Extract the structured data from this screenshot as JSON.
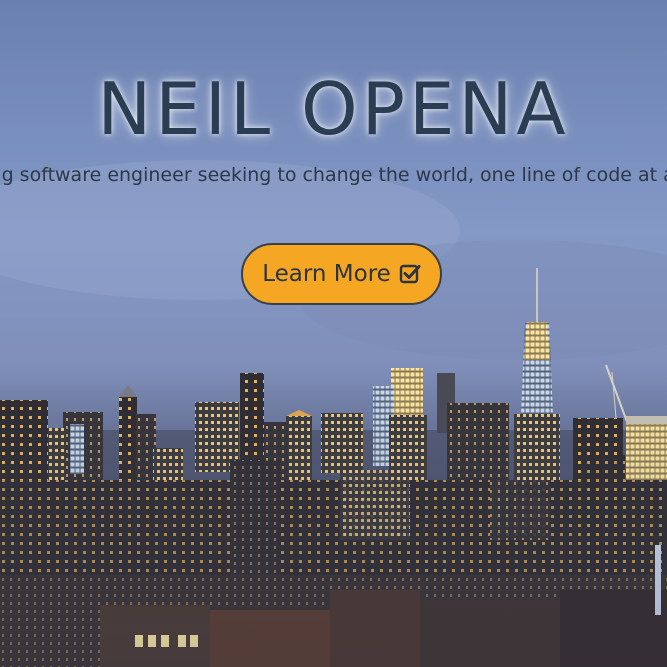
{
  "hero": {
    "title": "NEIL OPENA",
    "tagline": "Aspiring software engineer seeking to change the world, one line of code at a time.",
    "button_label": "Learn More",
    "button_icon": "check-square-icon"
  },
  "colors": {
    "button_fill": "#f5a623",
    "button_border": "#3a3f49",
    "title_text": "#2b3d52",
    "sky_top": "#6f86b6",
    "sky_bottom": "#8a9dc7"
  }
}
